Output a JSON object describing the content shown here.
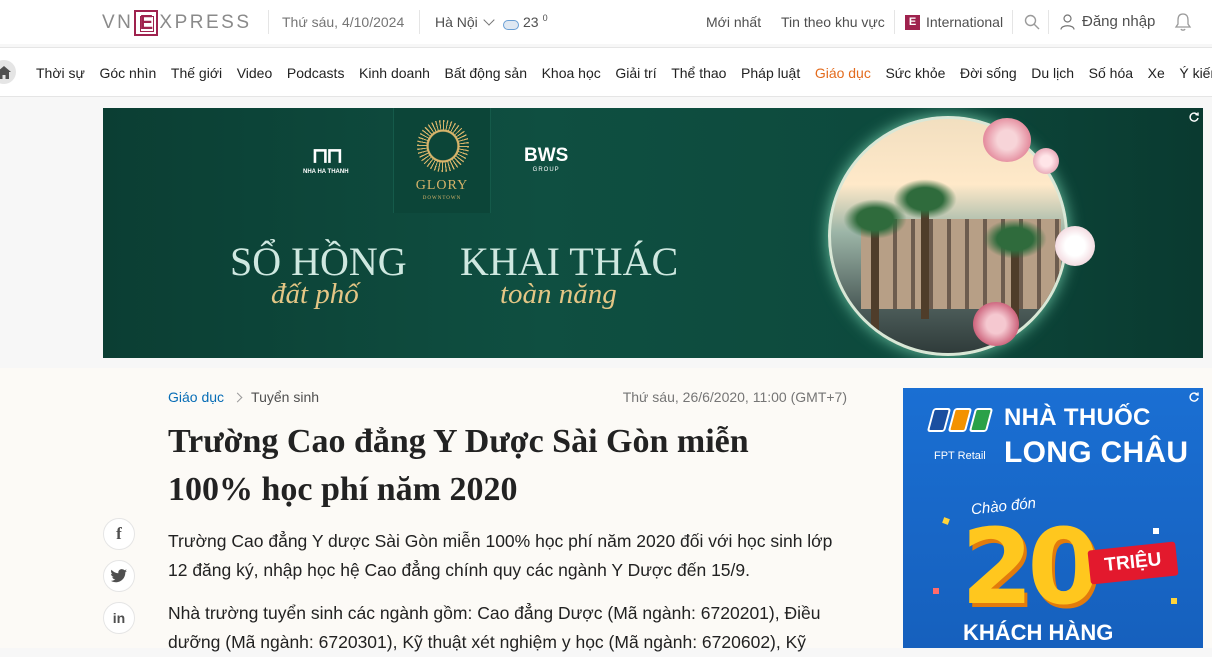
{
  "header": {
    "logo_parts": [
      "VN",
      "E",
      "XPRESS"
    ],
    "date": "Thứ sáu, 4/10/2024",
    "location": "Hà Nội",
    "temperature": "23",
    "temperature_unit": "0",
    "link_latest": "Mới nhất",
    "link_local": "Tin theo khu vực",
    "link_international": "International",
    "login": "Đăng nhập",
    "brand_color": "#9f224e"
  },
  "categories": [
    "Thời sự",
    "Góc nhìn",
    "Thế giới",
    "Video",
    "Podcasts",
    "Kinh doanh",
    "Bất động sản",
    "Khoa học",
    "Giải trí",
    "Thể thao",
    "Pháp luật",
    "Giáo dục",
    "Sức khỏe",
    "Đời sống",
    "Du lịch",
    "Số hóa",
    "Xe",
    "Ý kiến"
  ],
  "active_category": "Giáo dục",
  "banner_ad": {
    "brand_left": "NHA HA THANH",
    "brand_center": "GLORY",
    "brand_center_sub": "DOWNTOWN",
    "brand_right": "BWS",
    "brand_right_sub": "GROUP",
    "headline1": "SỔ HỒNG",
    "sub1": "đất phố",
    "headline2": "KHAI THÁC",
    "sub2": "toàn năng"
  },
  "article": {
    "breadcrumb": [
      "Giáo dục",
      "Tuyển sinh"
    ],
    "date": "Thứ sáu, 26/6/2020, 11:00 (GMT+7)",
    "title": "Trường Cao đẳng Y Dược Sài Gòn miễn 100% học phí năm 2020",
    "lead": "Trường Cao đẳng Y dược Sài Gòn miễn 100% học phí năm 2020 đối với học sinh lớp 12 đăng ký, nhập học hệ Cao đẳng chính quy các ngành Y Dược đến 15/9.",
    "paragraph": "Nhà trường tuyển sinh các ngành gồm: Cao đẳng Dược (Mã ngành: 6720201), Điều dưỡng (Mã ngành: 6720301), Kỹ thuật xét nghiệm y học (Mã ngành: 6720602), Kỹ"
  },
  "share_icons": [
    "facebook-icon",
    "twitter-icon",
    "linkedin-icon"
  ],
  "side_ad": {
    "brand": "FPT Retail",
    "line1": "NHÀ THUỐC",
    "line2": "LONG CHÂU",
    "welcome": "Chào đón",
    "number": "20",
    "unit": "TRIỆU",
    "bottom": "KHÁCH HÀNG"
  }
}
